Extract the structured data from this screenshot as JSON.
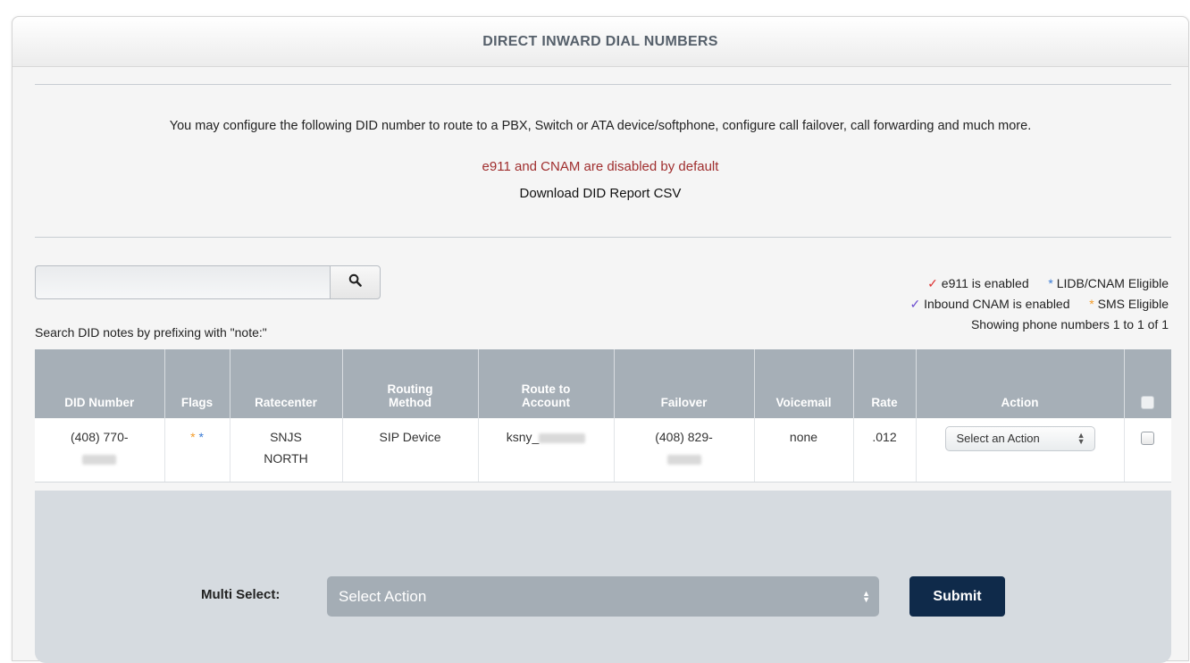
{
  "panel": {
    "title": "DIRECT INWARD DIAL NUMBERS",
    "intro": "You may configure the following DID number to route to a PBX, Switch or ATA device/softphone, configure call failover, call forwarding and much more.",
    "notice": "e911 and CNAM are disabled by default",
    "download_link": "Download DID Report CSV"
  },
  "search": {
    "value": "",
    "placeholder": "",
    "hint": "Search DID notes by prefixing with \"note:\""
  },
  "legend": {
    "e911": "e911 is enabled",
    "lidb": "LIDB/CNAM Eligible",
    "inbound_cnam": "Inbound CNAM is enabled",
    "sms": "SMS Eligible",
    "showing": "Showing phone numbers 1 to 1 of 1"
  },
  "table": {
    "headers": {
      "did": "DID Number",
      "flags": "Flags",
      "ratecenter": "Ratecenter",
      "routing_1": "Routing",
      "routing_2": "Method",
      "route_1": "Route to",
      "route_2": "Account",
      "failover": "Failover",
      "voicemail": "Voicemail",
      "rate": "Rate",
      "action": "Action"
    },
    "rows": [
      {
        "did": "(408) 770-",
        "ratecenter_1": "SNJS",
        "ratecenter_2": "NORTH",
        "routing": "SIP Device",
        "account": "ksny_",
        "failover": "(408) 829-",
        "voicemail": "none",
        "rate": ".012",
        "action": "Select an Action"
      }
    ]
  },
  "footer": {
    "multi_label": "Multi Select:",
    "multi_value": "Select Action",
    "submit": "Submit"
  },
  "colors": {
    "header_bg": "#a6afb7",
    "notice": "#a02f2f",
    "submit_bg": "#0f2a4a",
    "footer_bg": "#d6dbe0"
  }
}
